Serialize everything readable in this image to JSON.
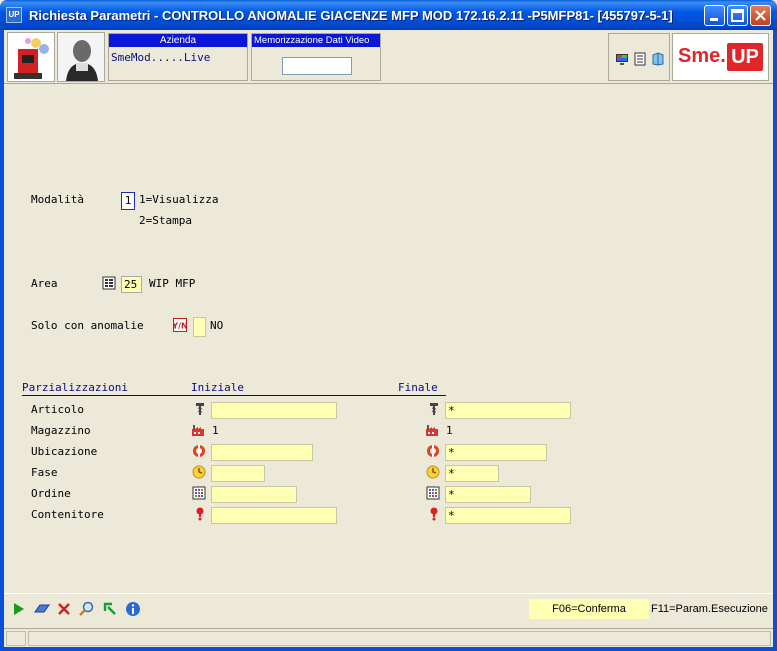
{
  "window": {
    "title": "Richiesta Parametri -  CONTROLLO ANOMALIE GIACENZE MFP MOD 172.16.2.11 -P5MFP81- [455797-5-1]",
    "app_badge": "UP"
  },
  "header": {
    "azienda_label": "Azienda",
    "azienda_value": "SmeMod.....Live",
    "memo_label": "Memorizzazione Dati Video",
    "memo_value": "",
    "brand": "Sme.",
    "brand_up": "UP"
  },
  "form": {
    "modalita_label": "Modalità",
    "modalita_value": "1",
    "option1": "1=Visualizza",
    "option2": "2=Stampa",
    "area_label": "Area",
    "area_value": "25",
    "area_desc": "WIP MFP",
    "anomalie_label": "Solo con anomalie",
    "anomalie_value": "",
    "anomalie_desc": "NO"
  },
  "ranges": {
    "header_main": "Parzializzazioni",
    "header_start": "Iniziale",
    "header_end": "Finale",
    "rows": [
      {
        "label": "Articolo",
        "start": "",
        "end": "*",
        "icon": "screw-icon"
      },
      {
        "label": "Magazzino",
        "start": "1",
        "end": "1",
        "icon": "factory-icon"
      },
      {
        "label": "Ubicazione",
        "start": "",
        "end": "*",
        "icon": "lifebuoy-icon"
      },
      {
        "label": "Fase",
        "start": "",
        "end": "*",
        "icon": "clock-icon"
      },
      {
        "label": "Ordine",
        "start": "",
        "end": "*",
        "icon": "grid-icon"
      },
      {
        "label": "Contenitore",
        "start": "",
        "end": "*",
        "icon": "exclamation-icon"
      }
    ]
  },
  "footer": {
    "f06": "F06=Conferma",
    "f11": "F11=Param.Esecuzione"
  },
  "colors": {
    "field_yellow": "#ffffb3",
    "label_blue": "#0a0a8a",
    "brand_red": "#e0262b"
  }
}
